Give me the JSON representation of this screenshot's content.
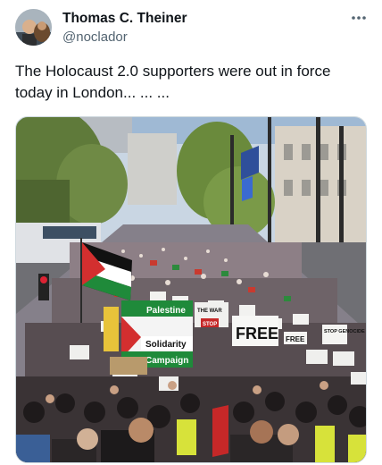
{
  "author": {
    "name": "Thomas C. Theiner",
    "handle": "@noclador"
  },
  "more_icon": "more-horizontal-icon",
  "tweet_text": "The Holocaust 2.0 supporters were out in force today in London... ... ...",
  "photo": {
    "signs": {
      "palestine": "Palestine",
      "solidarity": "Solidarity",
      "campaign": "Campaign",
      "free": "FREE",
      "free2": "FREE",
      "stop": "STOP",
      "stop_genocide": "STOP GENOCIDE",
      "the_war": "THE WAR"
    }
  }
}
